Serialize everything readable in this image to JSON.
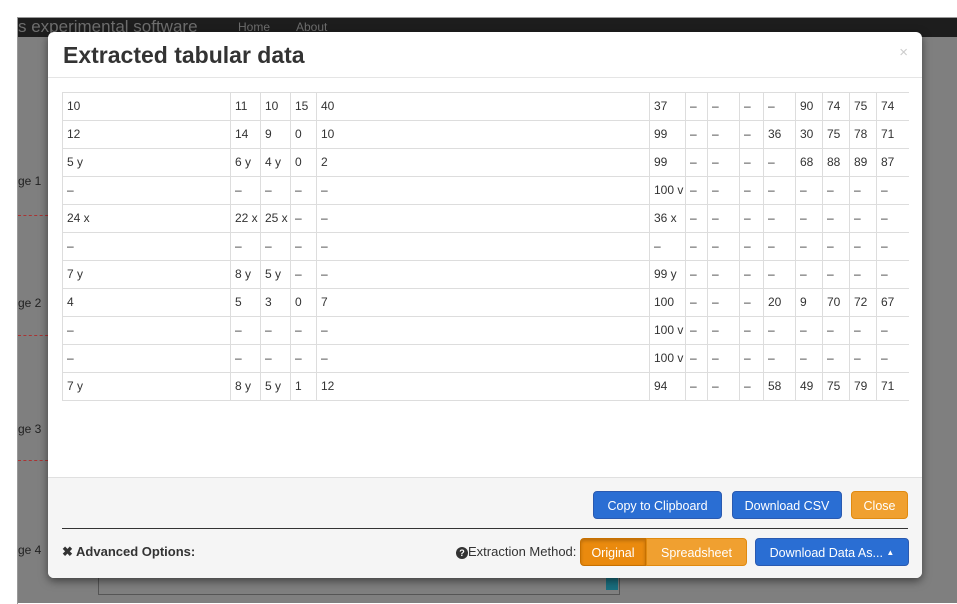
{
  "background": {
    "brand": "s experimental software",
    "nav": [
      "Home",
      "About"
    ],
    "page_labels": [
      "ge 1",
      "ge 2",
      "ge 3",
      "ge 4"
    ]
  },
  "modal": {
    "title": "Extracted tabular data",
    "close_icon": "×"
  },
  "table": {
    "rows": [
      [
        "10",
        "11",
        "10",
        "15",
        "40",
        "37",
        "–",
        "–",
        "–",
        "–",
        "90",
        "74",
        "75",
        "74"
      ],
      [
        "12",
        "14",
        "9",
        "0",
        "10",
        "99",
        "–",
        "–",
        "–",
        "36",
        "30",
        "75",
        "78",
        "71"
      ],
      [
        "5 y",
        "6 y",
        "4 y",
        "0",
        "2",
        "99",
        "–",
        "–",
        "–",
        "–",
        "68",
        "88",
        "89",
        "87"
      ],
      [
        "–",
        "–",
        "–",
        "–",
        "–",
        "100 v",
        "–",
        "–",
        "–",
        "–",
        "–",
        "–",
        "–",
        "–"
      ],
      [
        "24 x",
        "22 x",
        "25 x",
        "–",
        "–",
        "36 x",
        "–",
        "–",
        "–",
        "–",
        "–",
        "–",
        "–",
        "–"
      ],
      [
        "–",
        "–",
        "–",
        "–",
        "–",
        "–",
        "–",
        "–",
        "–",
        "–",
        "–",
        "–",
        "–",
        "–"
      ],
      [
        "7 y",
        "8 y",
        "5 y",
        "–",
        "–",
        "99 y",
        "–",
        "–",
        "–",
        "–",
        "–",
        "–",
        "–",
        "–"
      ],
      [
        "4",
        "5",
        "3",
        "0",
        "7",
        "100",
        "–",
        "–",
        "–",
        "20",
        "9",
        "70",
        "72",
        "67"
      ],
      [
        "–",
        "–",
        "–",
        "–",
        "–",
        "100 v",
        "–",
        "–",
        "–",
        "–",
        "–",
        "–",
        "–",
        "–"
      ],
      [
        "–",
        "–",
        "–",
        "–",
        "–",
        "100 v",
        "–",
        "–",
        "–",
        "–",
        "–",
        "–",
        "–",
        "–"
      ],
      [
        "7 y",
        "8 y",
        "5 y",
        "1",
        "12",
        "94",
        "–",
        "–",
        "–",
        "58",
        "49",
        "75",
        "79",
        "71"
      ]
    ]
  },
  "footer": {
    "copy_label": "Copy to Clipboard",
    "csv_label": "Download CSV",
    "close_label": "Close",
    "advanced_label": "Advanced Options:",
    "advanced_icon": "✖",
    "extraction_label": "Extraction Method:",
    "help_icon": "?",
    "method_original": "Original",
    "method_spreadsheet": "Spreadsheet",
    "download_as_label": "Download Data As...",
    "caret_icon": "▲"
  },
  "colors": {
    "primary": "#2a6ed3",
    "warning": "#f0a030",
    "backdrop": "#7f7f7f"
  }
}
